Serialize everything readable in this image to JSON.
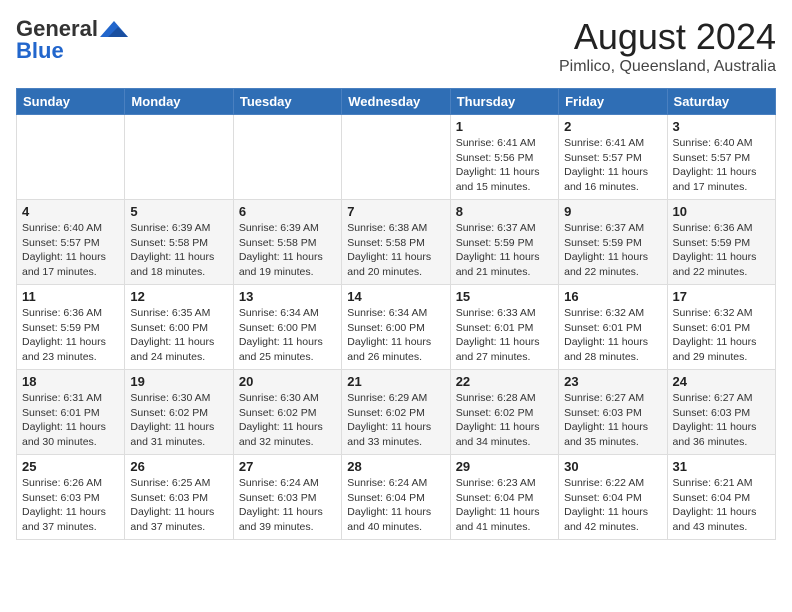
{
  "logo": {
    "general": "General",
    "blue": "Blue"
  },
  "header": {
    "month": "August 2024",
    "location": "Pimlico, Queensland, Australia"
  },
  "weekdays": [
    "Sunday",
    "Monday",
    "Tuesday",
    "Wednesday",
    "Thursday",
    "Friday",
    "Saturday"
  ],
  "rows": [
    [
      {
        "day": "",
        "info": ""
      },
      {
        "day": "",
        "info": ""
      },
      {
        "day": "",
        "info": ""
      },
      {
        "day": "",
        "info": ""
      },
      {
        "day": "1",
        "info": "Sunrise: 6:41 AM\nSunset: 5:56 PM\nDaylight: 11 hours and 15 minutes."
      },
      {
        "day": "2",
        "info": "Sunrise: 6:41 AM\nSunset: 5:57 PM\nDaylight: 11 hours and 16 minutes."
      },
      {
        "day": "3",
        "info": "Sunrise: 6:40 AM\nSunset: 5:57 PM\nDaylight: 11 hours and 17 minutes."
      }
    ],
    [
      {
        "day": "4",
        "info": "Sunrise: 6:40 AM\nSunset: 5:57 PM\nDaylight: 11 hours and 17 minutes."
      },
      {
        "day": "5",
        "info": "Sunrise: 6:39 AM\nSunset: 5:58 PM\nDaylight: 11 hours and 18 minutes."
      },
      {
        "day": "6",
        "info": "Sunrise: 6:39 AM\nSunset: 5:58 PM\nDaylight: 11 hours and 19 minutes."
      },
      {
        "day": "7",
        "info": "Sunrise: 6:38 AM\nSunset: 5:58 PM\nDaylight: 11 hours and 20 minutes."
      },
      {
        "day": "8",
        "info": "Sunrise: 6:37 AM\nSunset: 5:59 PM\nDaylight: 11 hours and 21 minutes."
      },
      {
        "day": "9",
        "info": "Sunrise: 6:37 AM\nSunset: 5:59 PM\nDaylight: 11 hours and 22 minutes."
      },
      {
        "day": "10",
        "info": "Sunrise: 6:36 AM\nSunset: 5:59 PM\nDaylight: 11 hours and 22 minutes."
      }
    ],
    [
      {
        "day": "11",
        "info": "Sunrise: 6:36 AM\nSunset: 5:59 PM\nDaylight: 11 hours and 23 minutes."
      },
      {
        "day": "12",
        "info": "Sunrise: 6:35 AM\nSunset: 6:00 PM\nDaylight: 11 hours and 24 minutes."
      },
      {
        "day": "13",
        "info": "Sunrise: 6:34 AM\nSunset: 6:00 PM\nDaylight: 11 hours and 25 minutes."
      },
      {
        "day": "14",
        "info": "Sunrise: 6:34 AM\nSunset: 6:00 PM\nDaylight: 11 hours and 26 minutes."
      },
      {
        "day": "15",
        "info": "Sunrise: 6:33 AM\nSunset: 6:01 PM\nDaylight: 11 hours and 27 minutes."
      },
      {
        "day": "16",
        "info": "Sunrise: 6:32 AM\nSunset: 6:01 PM\nDaylight: 11 hours and 28 minutes."
      },
      {
        "day": "17",
        "info": "Sunrise: 6:32 AM\nSunset: 6:01 PM\nDaylight: 11 hours and 29 minutes."
      }
    ],
    [
      {
        "day": "18",
        "info": "Sunrise: 6:31 AM\nSunset: 6:01 PM\nDaylight: 11 hours and 30 minutes."
      },
      {
        "day": "19",
        "info": "Sunrise: 6:30 AM\nSunset: 6:02 PM\nDaylight: 11 hours and 31 minutes."
      },
      {
        "day": "20",
        "info": "Sunrise: 6:30 AM\nSunset: 6:02 PM\nDaylight: 11 hours and 32 minutes."
      },
      {
        "day": "21",
        "info": "Sunrise: 6:29 AM\nSunset: 6:02 PM\nDaylight: 11 hours and 33 minutes."
      },
      {
        "day": "22",
        "info": "Sunrise: 6:28 AM\nSunset: 6:02 PM\nDaylight: 11 hours and 34 minutes."
      },
      {
        "day": "23",
        "info": "Sunrise: 6:27 AM\nSunset: 6:03 PM\nDaylight: 11 hours and 35 minutes."
      },
      {
        "day": "24",
        "info": "Sunrise: 6:27 AM\nSunset: 6:03 PM\nDaylight: 11 hours and 36 minutes."
      }
    ],
    [
      {
        "day": "25",
        "info": "Sunrise: 6:26 AM\nSunset: 6:03 PM\nDaylight: 11 hours and 37 minutes."
      },
      {
        "day": "26",
        "info": "Sunrise: 6:25 AM\nSunset: 6:03 PM\nDaylight: 11 hours and 37 minutes."
      },
      {
        "day": "27",
        "info": "Sunrise: 6:24 AM\nSunset: 6:03 PM\nDaylight: 11 hours and 39 minutes."
      },
      {
        "day": "28",
        "info": "Sunrise: 6:24 AM\nSunset: 6:04 PM\nDaylight: 11 hours and 40 minutes."
      },
      {
        "day": "29",
        "info": "Sunrise: 6:23 AM\nSunset: 6:04 PM\nDaylight: 11 hours and 41 minutes."
      },
      {
        "day": "30",
        "info": "Sunrise: 6:22 AM\nSunset: 6:04 PM\nDaylight: 11 hours and 42 minutes."
      },
      {
        "day": "31",
        "info": "Sunrise: 6:21 AM\nSunset: 6:04 PM\nDaylight: 11 hours and 43 minutes."
      }
    ]
  ]
}
